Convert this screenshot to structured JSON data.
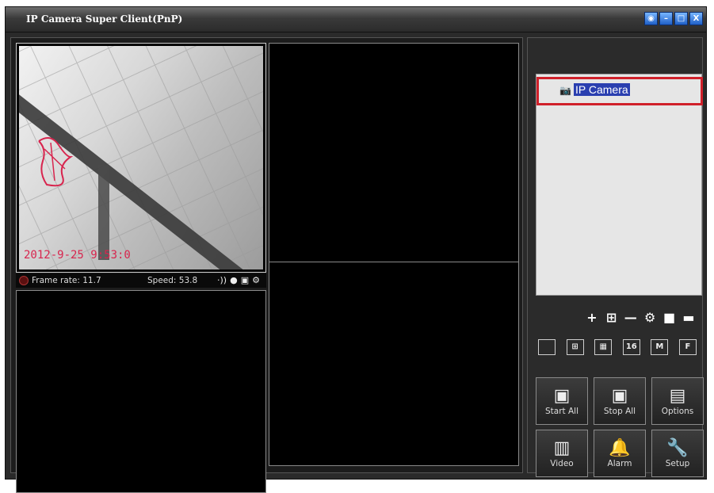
{
  "window": {
    "title": "IP Camera Super Client(PnP)"
  },
  "window_buttons": [
    {
      "name": "pin-button",
      "glyph": "◉"
    },
    {
      "name": "minimize-button",
      "glyph": "–"
    },
    {
      "name": "maximize-button",
      "glyph": "□"
    },
    {
      "name": "close-button",
      "glyph": "X"
    }
  ],
  "video": {
    "osd_timestamp": "2012-9-25 9:53:0",
    "status": {
      "frame_rate": "Frame rate: 11.7",
      "speed": "Speed: 53.8",
      "icons": [
        "audio-icon",
        "record-icon",
        "snapshot-icon",
        "settings-icon"
      ]
    }
  },
  "camera_list": {
    "items": [
      {
        "label": "IP Camera"
      }
    ]
  },
  "panel_toolbar": [
    {
      "name": "add-camera",
      "glyph": "+"
    },
    {
      "name": "add-device",
      "glyph": "⊞"
    },
    {
      "name": "remove-camera",
      "glyph": "—"
    },
    {
      "name": "camera-settings",
      "glyph": "⚙"
    },
    {
      "name": "record",
      "glyph": "■"
    },
    {
      "name": "more",
      "glyph": "▬"
    }
  ],
  "layouts": [
    {
      "name": "layout-1",
      "label": ""
    },
    {
      "name": "layout-4",
      "label": "⊞"
    },
    {
      "name": "layout-9",
      "label": "▦"
    },
    {
      "name": "layout-16",
      "label": "16"
    },
    {
      "name": "layout-m",
      "label": "M"
    },
    {
      "name": "layout-f",
      "label": "F"
    }
  ],
  "action_buttons": [
    {
      "name": "start-all-button",
      "label": "Start All",
      "icon": "▣"
    },
    {
      "name": "stop-all-button",
      "label": "Stop All",
      "icon": "▣"
    },
    {
      "name": "options-button",
      "label": "Options",
      "icon": "▤"
    },
    {
      "name": "video-button",
      "label": "Video",
      "icon": "▥"
    },
    {
      "name": "alarm-button",
      "label": "Alarm",
      "icon": "🔔"
    },
    {
      "name": "setup-button",
      "label": "Setup",
      "icon": "🔧"
    }
  ],
  "colors": {
    "highlight_box": "#d0202a",
    "selection": "#2a3fb0",
    "osd_text": "#d8254e"
  }
}
